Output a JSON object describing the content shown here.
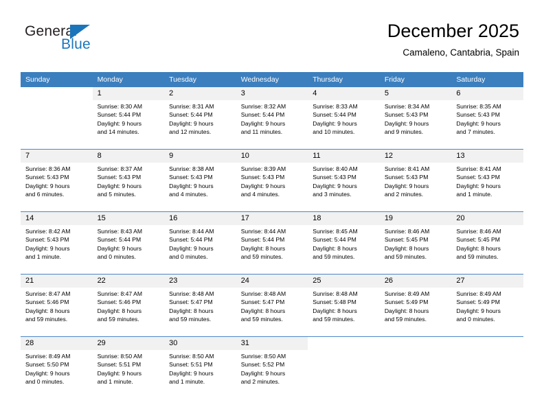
{
  "brand": {
    "name_top": "General",
    "name_bottom": "Blue",
    "accent_color": "#1b75bb"
  },
  "header": {
    "title": "December 2025",
    "subtitle": "Camaleno, Cantabria, Spain"
  },
  "theme": {
    "header_row_bg": "#3c7fbe",
    "header_row_text": "#ffffff",
    "daynum_band_bg": "#f1f1f1",
    "row_separator": "#4a86c5",
    "page_bg": "#ffffff",
    "text": "#000000"
  },
  "weekday_headers": [
    "Sunday",
    "Monday",
    "Tuesday",
    "Wednesday",
    "Thursday",
    "Friday",
    "Saturday"
  ],
  "weeks": [
    [
      {
        "day": "",
        "sunrise": "",
        "sunset": "",
        "daylight_1": "",
        "daylight_2": ""
      },
      {
        "day": "1",
        "sunrise": "Sunrise: 8:30 AM",
        "sunset": "Sunset: 5:44 PM",
        "daylight_1": "Daylight: 9 hours",
        "daylight_2": "and 14 minutes."
      },
      {
        "day": "2",
        "sunrise": "Sunrise: 8:31 AM",
        "sunset": "Sunset: 5:44 PM",
        "daylight_1": "Daylight: 9 hours",
        "daylight_2": "and 12 minutes."
      },
      {
        "day": "3",
        "sunrise": "Sunrise: 8:32 AM",
        "sunset": "Sunset: 5:44 PM",
        "daylight_1": "Daylight: 9 hours",
        "daylight_2": "and 11 minutes."
      },
      {
        "day": "4",
        "sunrise": "Sunrise: 8:33 AM",
        "sunset": "Sunset: 5:44 PM",
        "daylight_1": "Daylight: 9 hours",
        "daylight_2": "and 10 minutes."
      },
      {
        "day": "5",
        "sunrise": "Sunrise: 8:34 AM",
        "sunset": "Sunset: 5:43 PM",
        "daylight_1": "Daylight: 9 hours",
        "daylight_2": "and 9 minutes."
      },
      {
        "day": "6",
        "sunrise": "Sunrise: 8:35 AM",
        "sunset": "Sunset: 5:43 PM",
        "daylight_1": "Daylight: 9 hours",
        "daylight_2": "and 7 minutes."
      }
    ],
    [
      {
        "day": "7",
        "sunrise": "Sunrise: 8:36 AM",
        "sunset": "Sunset: 5:43 PM",
        "daylight_1": "Daylight: 9 hours",
        "daylight_2": "and 6 minutes."
      },
      {
        "day": "8",
        "sunrise": "Sunrise: 8:37 AM",
        "sunset": "Sunset: 5:43 PM",
        "daylight_1": "Daylight: 9 hours",
        "daylight_2": "and 5 minutes."
      },
      {
        "day": "9",
        "sunrise": "Sunrise: 8:38 AM",
        "sunset": "Sunset: 5:43 PM",
        "daylight_1": "Daylight: 9 hours",
        "daylight_2": "and 4 minutes."
      },
      {
        "day": "10",
        "sunrise": "Sunrise: 8:39 AM",
        "sunset": "Sunset: 5:43 PM",
        "daylight_1": "Daylight: 9 hours",
        "daylight_2": "and 4 minutes."
      },
      {
        "day": "11",
        "sunrise": "Sunrise: 8:40 AM",
        "sunset": "Sunset: 5:43 PM",
        "daylight_1": "Daylight: 9 hours",
        "daylight_2": "and 3 minutes."
      },
      {
        "day": "12",
        "sunrise": "Sunrise: 8:41 AM",
        "sunset": "Sunset: 5:43 PM",
        "daylight_1": "Daylight: 9 hours",
        "daylight_2": "and 2 minutes."
      },
      {
        "day": "13",
        "sunrise": "Sunrise: 8:41 AM",
        "sunset": "Sunset: 5:43 PM",
        "daylight_1": "Daylight: 9 hours",
        "daylight_2": "and 1 minute."
      }
    ],
    [
      {
        "day": "14",
        "sunrise": "Sunrise: 8:42 AM",
        "sunset": "Sunset: 5:43 PM",
        "daylight_1": "Daylight: 9 hours",
        "daylight_2": "and 1 minute."
      },
      {
        "day": "15",
        "sunrise": "Sunrise: 8:43 AM",
        "sunset": "Sunset: 5:44 PM",
        "daylight_1": "Daylight: 9 hours",
        "daylight_2": "and 0 minutes."
      },
      {
        "day": "16",
        "sunrise": "Sunrise: 8:44 AM",
        "sunset": "Sunset: 5:44 PM",
        "daylight_1": "Daylight: 9 hours",
        "daylight_2": "and 0 minutes."
      },
      {
        "day": "17",
        "sunrise": "Sunrise: 8:44 AM",
        "sunset": "Sunset: 5:44 PM",
        "daylight_1": "Daylight: 8 hours",
        "daylight_2": "and 59 minutes."
      },
      {
        "day": "18",
        "sunrise": "Sunrise: 8:45 AM",
        "sunset": "Sunset: 5:44 PM",
        "daylight_1": "Daylight: 8 hours",
        "daylight_2": "and 59 minutes."
      },
      {
        "day": "19",
        "sunrise": "Sunrise: 8:46 AM",
        "sunset": "Sunset: 5:45 PM",
        "daylight_1": "Daylight: 8 hours",
        "daylight_2": "and 59 minutes."
      },
      {
        "day": "20",
        "sunrise": "Sunrise: 8:46 AM",
        "sunset": "Sunset: 5:45 PM",
        "daylight_1": "Daylight: 8 hours",
        "daylight_2": "and 59 minutes."
      }
    ],
    [
      {
        "day": "21",
        "sunrise": "Sunrise: 8:47 AM",
        "sunset": "Sunset: 5:46 PM",
        "daylight_1": "Daylight: 8 hours",
        "daylight_2": "and 59 minutes."
      },
      {
        "day": "22",
        "sunrise": "Sunrise: 8:47 AM",
        "sunset": "Sunset: 5:46 PM",
        "daylight_1": "Daylight: 8 hours",
        "daylight_2": "and 59 minutes."
      },
      {
        "day": "23",
        "sunrise": "Sunrise: 8:48 AM",
        "sunset": "Sunset: 5:47 PM",
        "daylight_1": "Daylight: 8 hours",
        "daylight_2": "and 59 minutes."
      },
      {
        "day": "24",
        "sunrise": "Sunrise: 8:48 AM",
        "sunset": "Sunset: 5:47 PM",
        "daylight_1": "Daylight: 8 hours",
        "daylight_2": "and 59 minutes."
      },
      {
        "day": "25",
        "sunrise": "Sunrise: 8:48 AM",
        "sunset": "Sunset: 5:48 PM",
        "daylight_1": "Daylight: 8 hours",
        "daylight_2": "and 59 minutes."
      },
      {
        "day": "26",
        "sunrise": "Sunrise: 8:49 AM",
        "sunset": "Sunset: 5:49 PM",
        "daylight_1": "Daylight: 8 hours",
        "daylight_2": "and 59 minutes."
      },
      {
        "day": "27",
        "sunrise": "Sunrise: 8:49 AM",
        "sunset": "Sunset: 5:49 PM",
        "daylight_1": "Daylight: 9 hours",
        "daylight_2": "and 0 minutes."
      }
    ],
    [
      {
        "day": "28",
        "sunrise": "Sunrise: 8:49 AM",
        "sunset": "Sunset: 5:50 PM",
        "daylight_1": "Daylight: 9 hours",
        "daylight_2": "and 0 minutes."
      },
      {
        "day": "29",
        "sunrise": "Sunrise: 8:50 AM",
        "sunset": "Sunset: 5:51 PM",
        "daylight_1": "Daylight: 9 hours",
        "daylight_2": "and 1 minute."
      },
      {
        "day": "30",
        "sunrise": "Sunrise: 8:50 AM",
        "sunset": "Sunset: 5:51 PM",
        "daylight_1": "Daylight: 9 hours",
        "daylight_2": "and 1 minute."
      },
      {
        "day": "31",
        "sunrise": "Sunrise: 8:50 AM",
        "sunset": "Sunset: 5:52 PM",
        "daylight_1": "Daylight: 9 hours",
        "daylight_2": "and 2 minutes."
      },
      {
        "day": "",
        "sunrise": "",
        "sunset": "",
        "daylight_1": "",
        "daylight_2": ""
      },
      {
        "day": "",
        "sunrise": "",
        "sunset": "",
        "daylight_1": "",
        "daylight_2": ""
      },
      {
        "day": "",
        "sunrise": "",
        "sunset": "",
        "daylight_1": "",
        "daylight_2": ""
      }
    ]
  ]
}
